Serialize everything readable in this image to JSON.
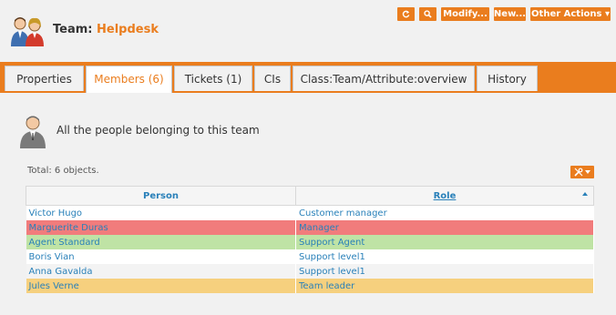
{
  "header": {
    "title_prefix": "Team:",
    "title_name": "Helpdesk",
    "icon": "team-icon"
  },
  "actions": {
    "refresh_icon": "refresh-icon",
    "search_icon": "search-icon",
    "modify_label": "Modify...",
    "new_label": "New...",
    "other_label": "Other Actions ▾"
  },
  "tabs": [
    {
      "label": "Properties"
    },
    {
      "label": "Members (6)"
    },
    {
      "label": "Tickets (1)"
    },
    {
      "label": "CIs"
    },
    {
      "label": "Class:Team/Attribute:overview"
    },
    {
      "label": "History"
    }
  ],
  "members": {
    "description": "All the people belonging to this team",
    "total": "Total: 6 objects.",
    "columns": {
      "person": "Person",
      "role": "Role"
    },
    "rows": [
      {
        "person": "Victor Hugo",
        "role": "Customer manager"
      },
      {
        "person": "Marguerite Duras",
        "role": "Manager"
      },
      {
        "person": "Agent Standard",
        "role": "Support Agent"
      },
      {
        "person": "Boris Vian",
        "role": "Support level1"
      },
      {
        "person": "Anna Gavalda",
        "role": "Support level1"
      },
      {
        "person": "Jules Verne",
        "role": "Team leader"
      }
    ]
  },
  "colors": {
    "accent": "#ea7d1e",
    "link": "#2980b9",
    "row_red": "#f17c7c",
    "row_green": "#bfe3a5",
    "row_yellow": "#f6d07e"
  }
}
